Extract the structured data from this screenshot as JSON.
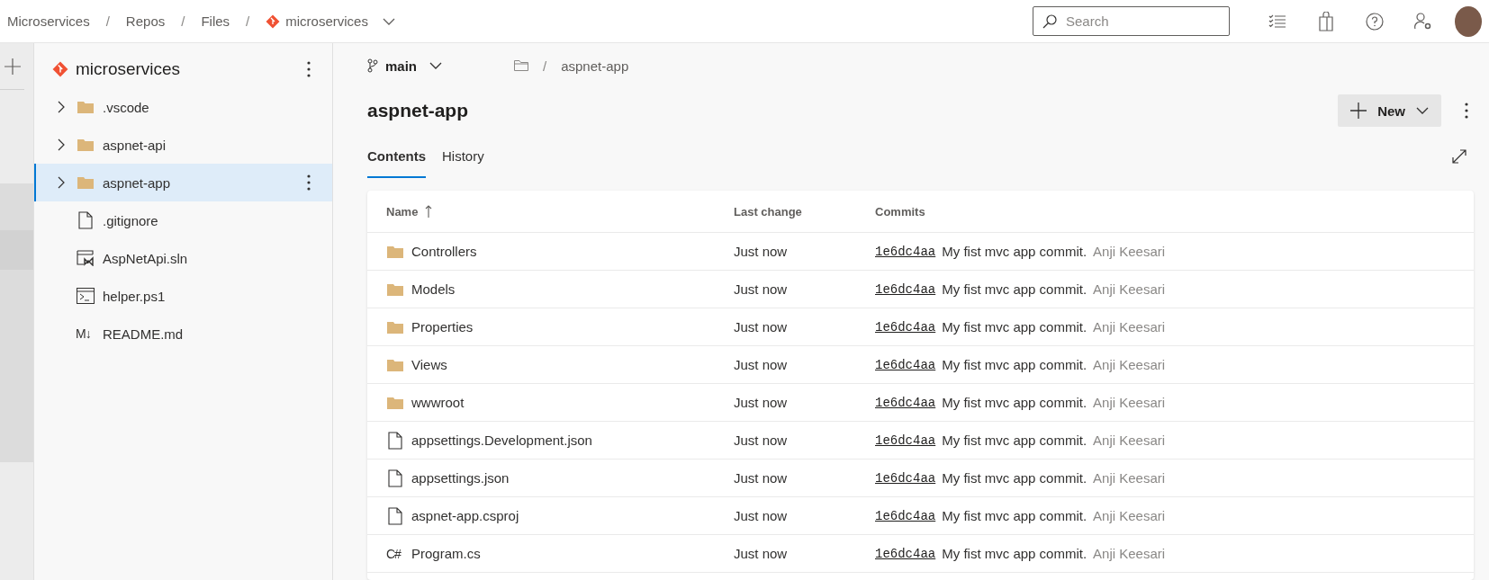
{
  "breadcrumb": {
    "items": [
      "Microservices",
      "Repos",
      "Files"
    ],
    "separator": "/",
    "repo": "microservices"
  },
  "search": {
    "placeholder": "Search"
  },
  "sidebar": {
    "title": "microservices",
    "items": [
      {
        "name": ".vscode",
        "kind": "folder",
        "expanded": false,
        "selected": false
      },
      {
        "name": "aspnet-api",
        "kind": "folder",
        "expanded": false,
        "selected": false
      },
      {
        "name": "aspnet-app",
        "kind": "folder",
        "expanded": false,
        "selected": true
      },
      {
        "name": ".gitignore",
        "kind": "file",
        "selected": false
      },
      {
        "name": "AspNetApi.sln",
        "kind": "solution",
        "selected": false
      },
      {
        "name": "helper.ps1",
        "kind": "script",
        "selected": false
      },
      {
        "name": "README.md",
        "kind": "markdown",
        "icon_text": "M↓",
        "selected": false
      }
    ]
  },
  "branch": {
    "name": "main",
    "separator": "/",
    "path": "aspnet-app"
  },
  "title": "aspnet-app",
  "new_button": "New",
  "tabs": [
    {
      "label": "Contents",
      "selected": true
    },
    {
      "label": "History",
      "selected": false
    }
  ],
  "table": {
    "columns": [
      {
        "label": "Name",
        "sorted": true
      },
      {
        "label": "Last change"
      },
      {
        "label": "Commits"
      }
    ],
    "rows": [
      {
        "name": "Controllers",
        "kind": "folder",
        "last_change": "Just now",
        "commit": "1e6dc4aa",
        "message": "My fist mvc app commit.",
        "author": "Anji Keesari"
      },
      {
        "name": "Models",
        "kind": "folder",
        "last_change": "Just now",
        "commit": "1e6dc4aa",
        "message": "My fist mvc app commit.",
        "author": "Anji Keesari"
      },
      {
        "name": "Properties",
        "kind": "folder",
        "last_change": "Just now",
        "commit": "1e6dc4aa",
        "message": "My fist mvc app commit.",
        "author": "Anji Keesari"
      },
      {
        "name": "Views",
        "kind": "folder",
        "last_change": "Just now",
        "commit": "1e6dc4aa",
        "message": "My fist mvc app commit.",
        "author": "Anji Keesari"
      },
      {
        "name": "wwwroot",
        "kind": "folder",
        "last_change": "Just now",
        "commit": "1e6dc4aa",
        "message": "My fist mvc app commit.",
        "author": "Anji Keesari"
      },
      {
        "name": "appsettings.Development.json",
        "kind": "file",
        "last_change": "Just now",
        "commit": "1e6dc4aa",
        "message": "My fist mvc app commit.",
        "author": "Anji Keesari"
      },
      {
        "name": "appsettings.json",
        "kind": "file",
        "last_change": "Just now",
        "commit": "1e6dc4aa",
        "message": "My fist mvc app commit.",
        "author": "Anji Keesari"
      },
      {
        "name": "aspnet-app.csproj",
        "kind": "file",
        "last_change": "Just now",
        "commit": "1e6dc4aa",
        "message": "My fist mvc app commit.",
        "author": "Anji Keesari"
      },
      {
        "name": "Program.cs",
        "kind": "code",
        "icon_text": "C#",
        "last_change": "Just now",
        "commit": "1e6dc4aa",
        "message": "My fist mvc app commit.",
        "author": "Anji Keesari"
      }
    ]
  }
}
